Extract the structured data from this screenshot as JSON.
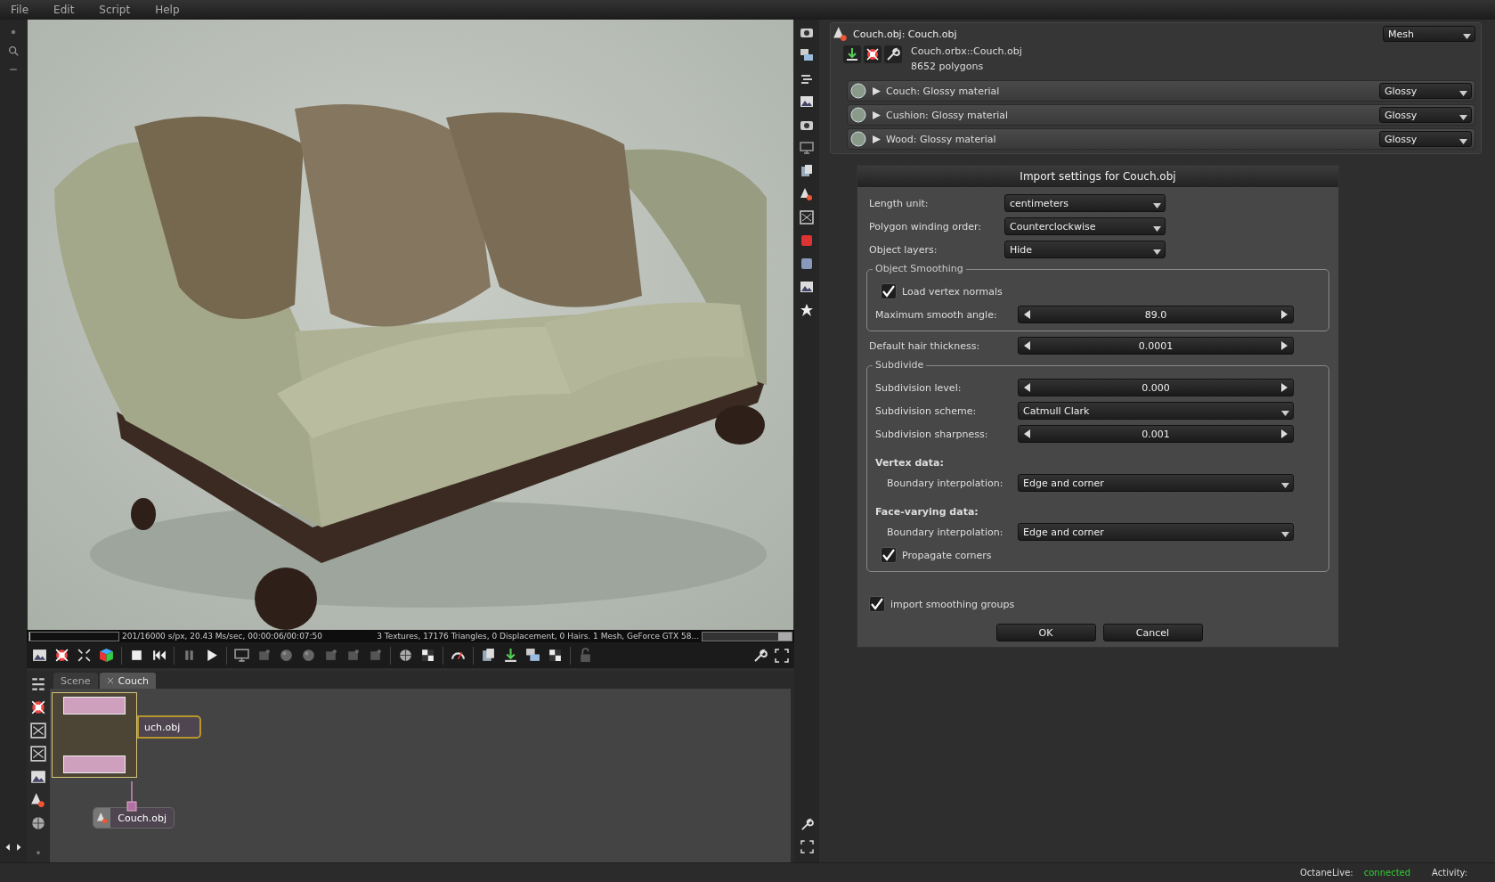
{
  "menu": [
    "File",
    "Edit",
    "Script",
    "Help"
  ],
  "viewport": {
    "progress": {
      "level": 0.01
    },
    "stats_left": "201/16000 s/px, 20.43 Ms/sec, 00:00:06/00:07:50",
    "stats_right": "3 Textures, 17176 Triangles, 0 Displacement, 0 Hairs. 1 Mesh, GeForce GTX 58...",
    "gpu_meter": {
      "level": 0.85
    }
  },
  "node_graph": {
    "tabs": [
      {
        "label": "Scene",
        "selected": false,
        "closable": false
      },
      {
        "label": "Couch",
        "selected": true,
        "closable": true
      }
    ],
    "nodes": [
      {
        "label": "uch.obj",
        "selected": true
      },
      {
        "label": "Couch.obj",
        "selected": false
      }
    ]
  },
  "inspector": {
    "title": "Couch.obj: Couch.obj",
    "type": "Mesh",
    "path": "Couch.orbx::Couch.obj",
    "polygons": "8652 polygons",
    "materials": [
      {
        "name": "Couch: Glossy material",
        "type": "Glossy",
        "expanded": false
      },
      {
        "name": "Cushion: Glossy material",
        "type": "Glossy",
        "expanded": false
      },
      {
        "name": "Wood: Glossy material",
        "type": "Glossy",
        "expanded": false
      }
    ]
  },
  "dialog": {
    "title": "Import settings for Couch.obj",
    "items": [
      {
        "kind": "dropdown",
        "label": "Length unit:",
        "value": "centimeters"
      },
      {
        "kind": "dropdown",
        "label": "Polygon winding order:",
        "value": "Counterclockwise"
      },
      {
        "kind": "dropdown",
        "label": "Object layers:",
        "value": "Hide"
      },
      {
        "kind": "group",
        "label": "Object Smoothing",
        "children": [
          {
            "kind": "checkbox",
            "label": "Load vertex normals",
            "checked": true
          },
          {
            "kind": "stepper",
            "label": "Maximum smooth angle:",
            "value": "89.0"
          }
        ]
      },
      {
        "kind": "stepper",
        "label": "Default hair thickness:",
        "value": "0.0001"
      },
      {
        "kind": "group",
        "label": "Subdivide",
        "children": [
          {
            "kind": "stepper",
            "label": "Subdivision level:",
            "value": "0.000"
          },
          {
            "kind": "dropdown",
            "label": "Subdivision scheme:",
            "value": "Catmull Clark"
          },
          {
            "kind": "stepper",
            "label": "Subdivision sharpness:",
            "value": "0.001"
          },
          {
            "kind": "heading",
            "label": "Vertex data:"
          },
          {
            "kind": "dropdown",
            "label": "Boundary interpolation:",
            "value": "Edge and corner",
            "indented": true
          },
          {
            "kind": "heading",
            "label": "Face-varying data:"
          },
          {
            "kind": "dropdown",
            "label": "Boundary interpolation:",
            "value": "Edge and corner",
            "indented": true
          },
          {
            "kind": "checkbox",
            "label": "Propagate corners",
            "checked": true
          }
        ]
      },
      {
        "kind": "checkbox",
        "label": "import smoothing groups",
        "checked": true
      }
    ],
    "buttons": [
      "OK",
      "Cancel"
    ]
  },
  "status_bar": {
    "service": "OctaneLive:",
    "state": {
      "label": "connected",
      "color": "#33cc33"
    },
    "activity": "Activity:"
  }
}
